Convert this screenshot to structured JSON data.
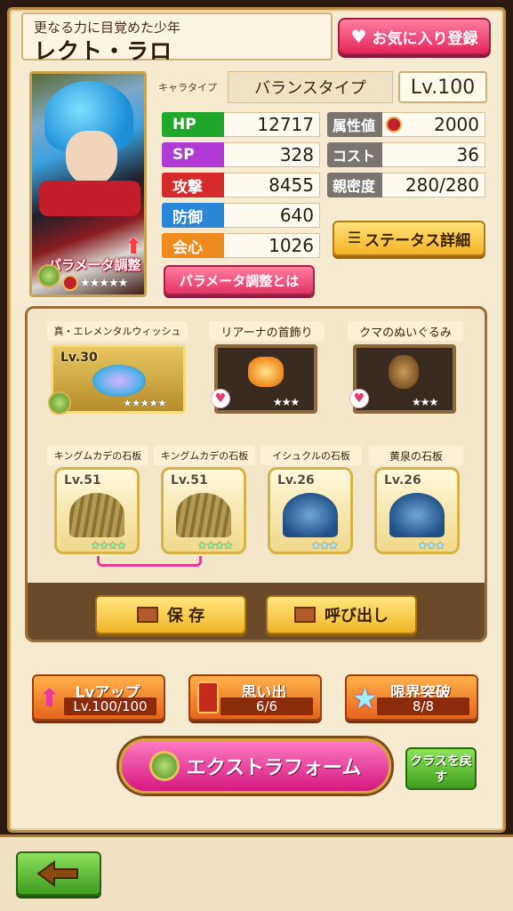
{
  "header": {
    "subtitle": "更なる力に目覚めた少年",
    "name": "レクト・ラロ",
    "favorite_label": "お気に入り登録"
  },
  "portrait": {
    "overlay_label": "パラメータ調整",
    "rarity_stars": "★★★★★"
  },
  "chara_type": {
    "label": "キャラタイプ",
    "value": "バランスタイプ",
    "level": "Lv.100"
  },
  "stats_left": [
    {
      "label": "HP",
      "value": "12717",
      "color": "#1fa82c"
    },
    {
      "label": "SP",
      "value": "328",
      "color": "#b23ad4"
    },
    {
      "label": "攻撃",
      "value": "8455",
      "color": "#d42a2a"
    },
    {
      "label": "防御",
      "value": "640",
      "color": "#2a86d6"
    },
    {
      "label": "会心",
      "value": "1026",
      "color": "#ef8a1e"
    }
  ],
  "stats_right": [
    {
      "label": "属性値",
      "value": "2000"
    },
    {
      "label": "コスト",
      "value": "36"
    },
    {
      "label": "親密度",
      "value": "280/280"
    }
  ],
  "buttons": {
    "status_detail": "ステータス詳細",
    "param_about": "パラメータ調整とは",
    "save": "保 存",
    "load": "呼び出し",
    "extra_form": "エクストラフォーム",
    "class_back": "クラスを戻す"
  },
  "weapons": [
    {
      "name": "真・エレメンタルウィッシュ",
      "level": "Lv.30",
      "stars": "★★★★★"
    },
    {
      "name": "リアーナの首飾り",
      "stars": "★★★"
    },
    {
      "name": "クマのぬいぐるみ",
      "stars": "★★★"
    }
  ],
  "tablets": [
    {
      "name": "キングムカデの石板",
      "level": "Lv.51",
      "stars": "★★★★"
    },
    {
      "name": "キングムカデの石板",
      "level": "Lv.51",
      "stars": "★★★★"
    },
    {
      "name": "イシュクルの石板",
      "level": "Lv.26",
      "stars": "★★★"
    },
    {
      "name": "黄泉の石板",
      "level": "Lv.26",
      "stars": "★★★"
    }
  ],
  "actions": [
    {
      "title": "Lvアップ",
      "value": "Lv.100/100"
    },
    {
      "title": "思い出",
      "value": "6/6"
    },
    {
      "title": "限界突破",
      "value": "8/8"
    }
  ]
}
